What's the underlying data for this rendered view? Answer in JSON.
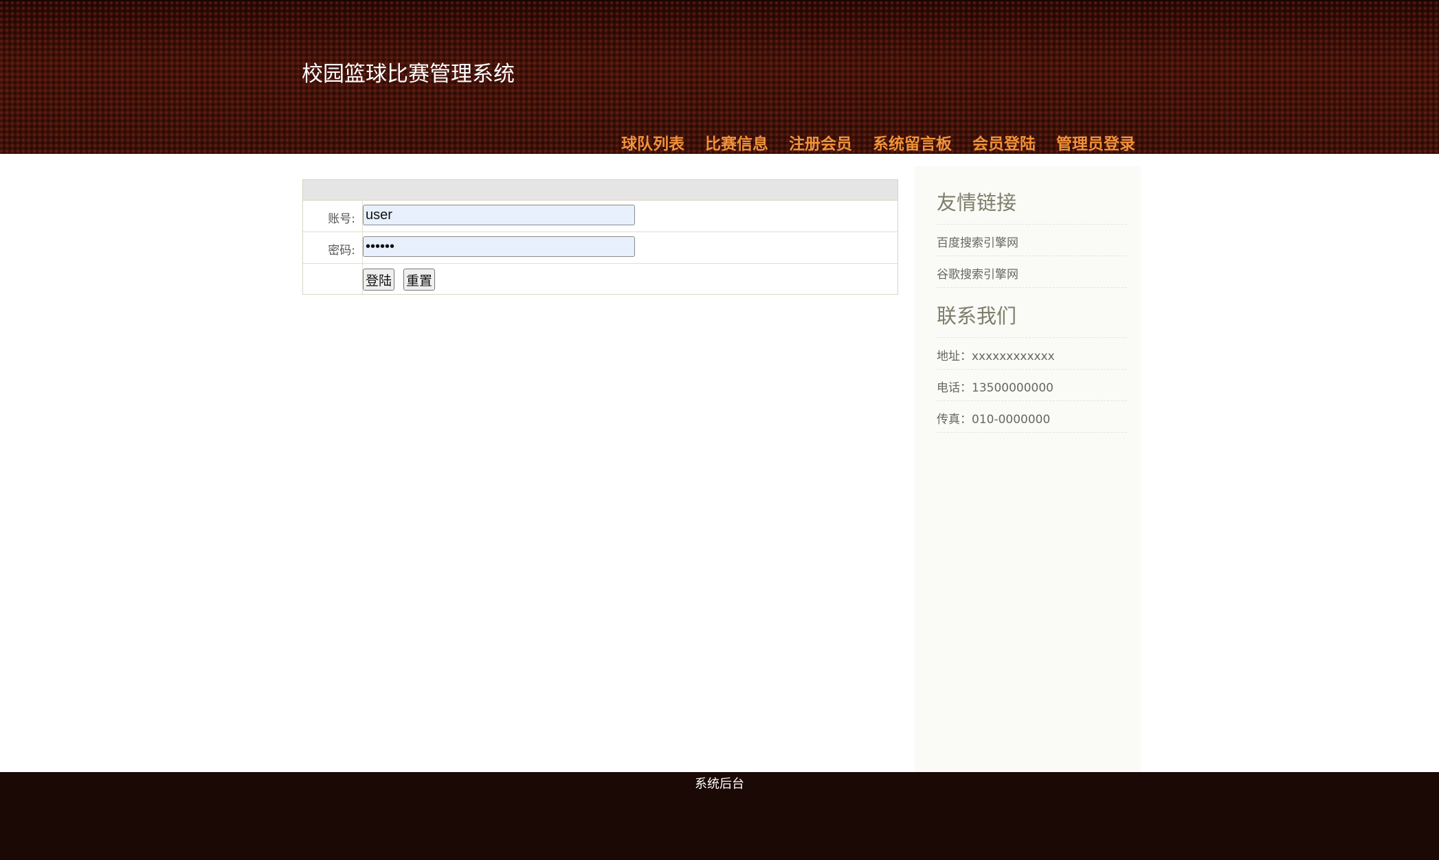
{
  "header": {
    "site_title": "校园篮球比赛管理系统",
    "nav": [
      {
        "label": "球队列表"
      },
      {
        "label": "比赛信息"
      },
      {
        "label": "注册会员"
      },
      {
        "label": "系统留言板"
      },
      {
        "label": "会员登陆"
      },
      {
        "label": "管理员登录"
      }
    ]
  },
  "login": {
    "account_label": "账号:",
    "account_value": "user",
    "password_label": "密码:",
    "password_value": "123456",
    "login_button": "登陆",
    "reset_button": "重置"
  },
  "sidebar": {
    "links_title": "友情链接",
    "links": [
      {
        "label": "百度搜索引擎网"
      },
      {
        "label": "谷歌搜索引擎网"
      }
    ],
    "contact_title": "联系我们",
    "contact": [
      {
        "text": "地址：xxxxxxxxxxxx"
      },
      {
        "text": "电话：13500000000"
      },
      {
        "text": "传真：010-0000000"
      }
    ]
  },
  "footer": {
    "admin_link": "系统后台"
  },
  "colors": {
    "header_bg": "#3a0f08",
    "nav_text": "#f2923a",
    "footer_bg": "#1a0904",
    "input_bg": "#e8f0fe"
  }
}
